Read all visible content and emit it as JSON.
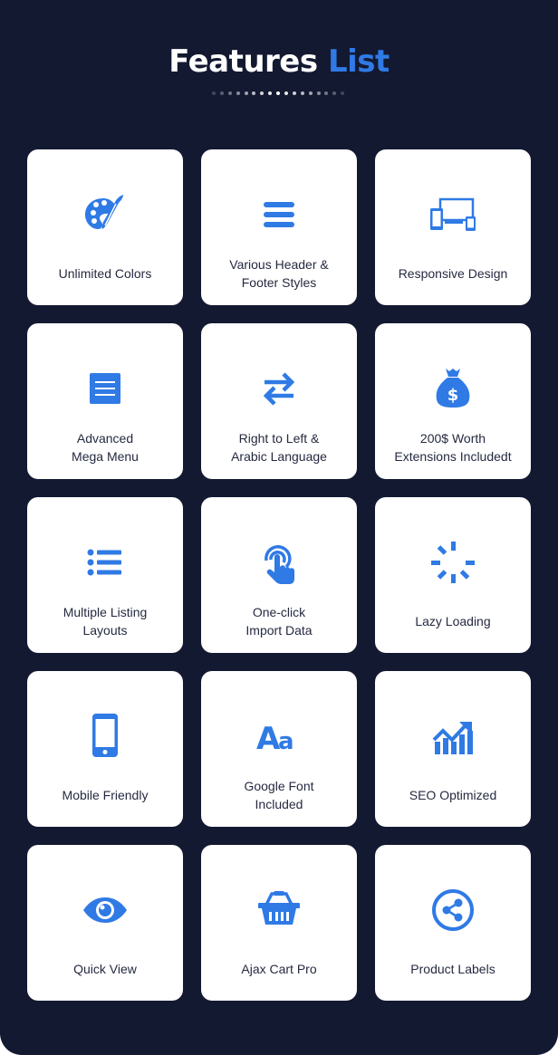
{
  "header": {
    "title_main": "Features",
    "title_accent": "List",
    "accent_color": "#2f7ae5",
    "divider_dots": 17
  },
  "features": [
    {
      "label": "Unlimited Colors",
      "icon": "palette-icon"
    },
    {
      "label": "Various Header &\nFooter Styles",
      "icon": "menu-bars-icon"
    },
    {
      "label": "Responsive Design",
      "icon": "devices-icon"
    },
    {
      "label": "Advanced\nMega Menu",
      "icon": "document-list-icon"
    },
    {
      "label": "Right to Left &\nArabic Language",
      "icon": "swap-arrows-icon"
    },
    {
      "label": "200$ Worth\nExtensions Includedt",
      "icon": "money-bag-icon"
    },
    {
      "label": "Multiple Listing\nLayouts",
      "icon": "list-icon"
    },
    {
      "label": "One-click\nImport Data",
      "icon": "tap-hand-icon"
    },
    {
      "label": "Lazy Loading",
      "icon": "spinner-icon"
    },
    {
      "label": "Mobile Friendly",
      "icon": "smartphone-icon"
    },
    {
      "label": "Google Font\nIncluded",
      "icon": "font-icon"
    },
    {
      "label": "SEO Optimized",
      "icon": "growth-chart-icon"
    },
    {
      "label": "Quick View",
      "icon": "eye-icon"
    },
    {
      "label": "Ajax Cart Pro",
      "icon": "basket-icon"
    },
    {
      "label": "Product Labels",
      "icon": "share-icon"
    }
  ]
}
